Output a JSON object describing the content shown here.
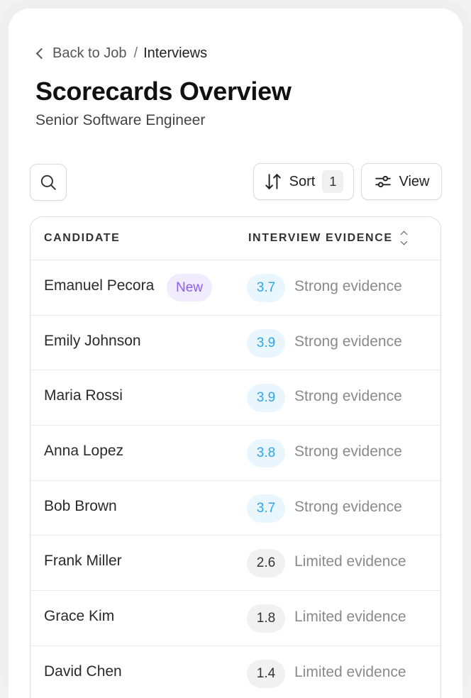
{
  "breadcrumb": {
    "back_label": "Back to Job",
    "separator": "/",
    "current": "Interviews"
  },
  "header": {
    "title": "Scorecards Overview",
    "subtitle": "Senior Software Engineer"
  },
  "toolbar": {
    "sort_label": "Sort",
    "sort_count": "1",
    "view_label": "View"
  },
  "table": {
    "columns": {
      "candidate": "CANDIDATE",
      "evidence": "INTERVIEW EVIDENCE"
    },
    "rows": [
      {
        "name": "Emanuel Pecora",
        "badge": "New",
        "score": "3.7",
        "evidence": "Strong evidence",
        "level": "strong"
      },
      {
        "name": "Emily Johnson",
        "score": "3.9",
        "evidence": "Strong evidence",
        "level": "strong"
      },
      {
        "name": "Maria Rossi",
        "score": "3.9",
        "evidence": "Strong evidence",
        "level": "strong"
      },
      {
        "name": "Anna Lopez",
        "score": "3.8",
        "evidence": "Strong evidence",
        "level": "strong"
      },
      {
        "name": "Bob Brown",
        "score": "3.7",
        "evidence": "Strong evidence",
        "level": "strong"
      },
      {
        "name": "Frank Miller",
        "score": "2.6",
        "evidence": "Limited evidence",
        "level": "limited"
      },
      {
        "name": "Grace Kim",
        "score": "1.8",
        "evidence": "Limited evidence",
        "level": "limited"
      },
      {
        "name": "David Chen",
        "score": "1.4",
        "evidence": "Limited evidence",
        "level": "limited"
      }
    ]
  },
  "colors": {
    "strong_score": "#2ea6e8",
    "new_badge": "#8b5cf6"
  }
}
